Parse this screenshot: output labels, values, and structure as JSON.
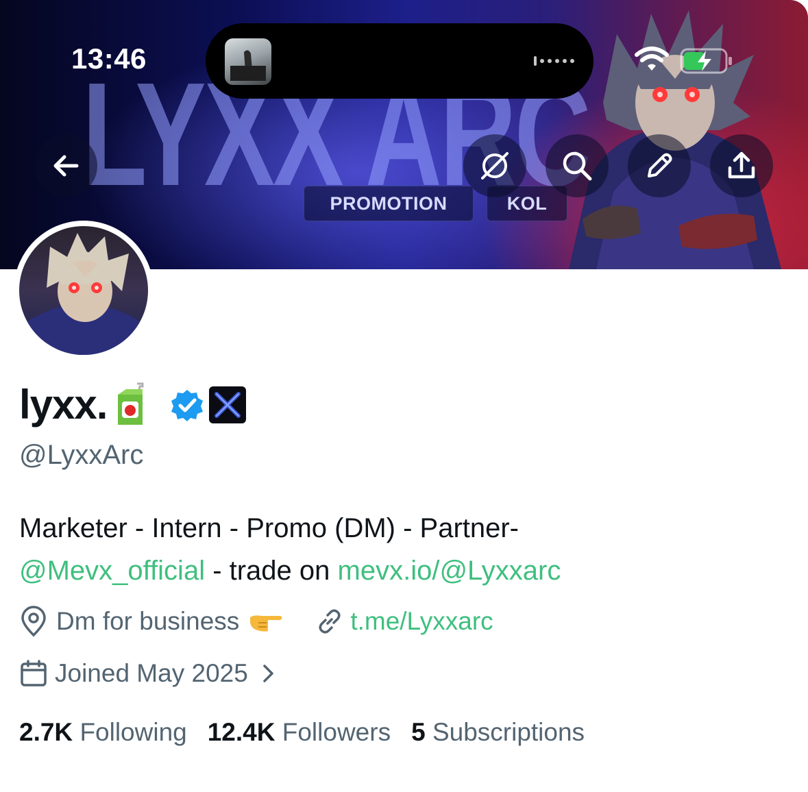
{
  "status_bar": {
    "time": "13:46"
  },
  "banner": {
    "word": "LYXX ARC",
    "chips": [
      "PROMOTION",
      "KOL"
    ]
  },
  "nav": {
    "icons": [
      "back-arrow-icon",
      "grok-icon",
      "search-icon",
      "edit-icon",
      "share-icon"
    ]
  },
  "profile": {
    "display_name": "lyxx.",
    "handle": "@LyxxArc",
    "bio_line1": "Marketer - Intern - Promo (DM) - Partner-",
    "bio_mention": "@Mevx_official",
    "bio_mid": " - trade on ",
    "bio_link": "mevx.io/@Lyxxarc",
    "location": "Dm for business",
    "website": "t.me/Lyxxarc",
    "joined": "Joined May 2025"
  },
  "stats": {
    "following_count": "2.7K",
    "following_label": "Following",
    "followers_count": "12.4K",
    "followers_label": "Followers",
    "subs_count": "5",
    "subs_label": "Subscriptions"
  },
  "colors": {
    "link": "#3fbf7f",
    "verified": "#1d9bf0",
    "secondary_text": "#536471"
  }
}
